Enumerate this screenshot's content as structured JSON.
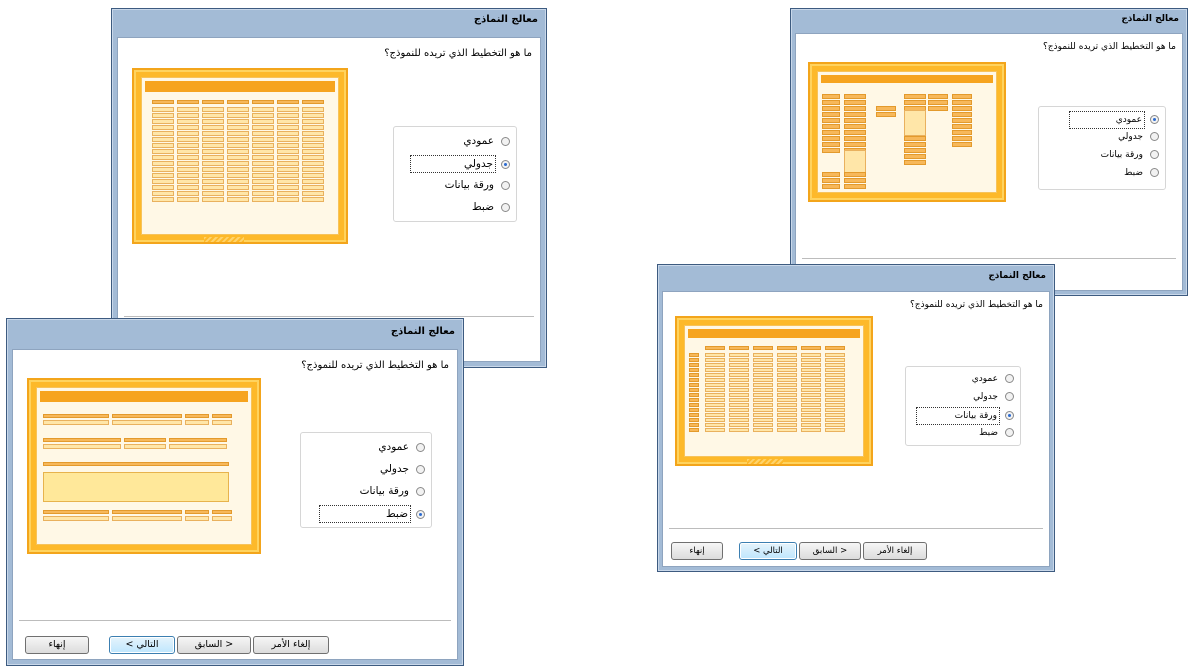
{
  "wizard": {
    "title": "معالج النماذج",
    "question": "ما هو التخطيط الذي تريده للنموذج؟",
    "options": [
      "عمودي",
      "جدولي",
      "ورقة بيانات",
      "ضبط"
    ],
    "buttons": {
      "cancel": "إلغاء الأمر",
      "back": "< السابق",
      "next": "التالي >",
      "finish": "إنهاء"
    }
  },
  "windows": [
    {
      "id": "tabular",
      "selected": "جدولي"
    },
    {
      "id": "columnar",
      "selected": "عمودي"
    },
    {
      "id": "datasheet",
      "selected": "ورقة بيانات"
    },
    {
      "id": "justified",
      "selected": "ضبط"
    }
  ],
  "colors": {
    "frame": "#a3bbd6",
    "preview_orange": "#fdb92a",
    "field_orange": "#f7b85a"
  }
}
